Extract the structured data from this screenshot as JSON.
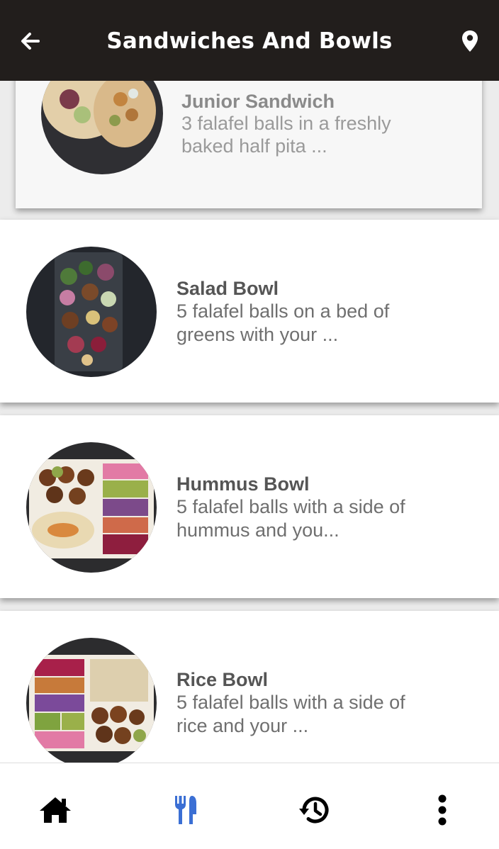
{
  "header": {
    "title": "Sandwiches And Bowls",
    "back_icon": "arrow-left-icon",
    "location_icon": "map-pin-icon"
  },
  "items": [
    {
      "name": "Junior Sandwich",
      "desc_line1": "3 falafel balls in a freshly",
      "desc_line2": "baked half pita ..."
    },
    {
      "name": "Salad Bowl",
      "desc_line1": "5 falafel balls on a bed of",
      "desc_line2": "greens with your ..."
    },
    {
      "name": "Hummus Bowl",
      "desc_line1": "5 falafel balls with a side of",
      "desc_line2": "hummus and you..."
    },
    {
      "name": "Rice Bowl",
      "desc_line1": "5 falafel balls with a side of",
      "desc_line2": "rice and your ..."
    }
  ],
  "nav": {
    "items": [
      "home-icon",
      "utensils-icon",
      "history-icon",
      "more-vertical-icon"
    ],
    "active": "utensils-icon",
    "active_color": "#3b6fd4"
  },
  "colors": {
    "header_bg": "#221e1c",
    "title_text": "#ffffff",
    "item_name": "#555555",
    "item_desc": "#6f6f6f"
  }
}
